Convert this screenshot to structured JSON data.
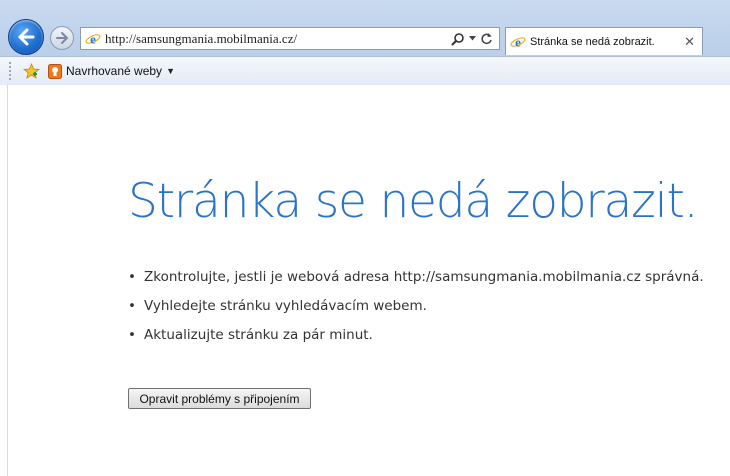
{
  "browser": {
    "address_url": "http://samsungmania.mobilmania.cz/",
    "tab_title": "Stránka se nedá zobrazit.",
    "tab_close": "✕",
    "favorites_bar": {
      "suggested_sites_label": "Navrhované weby",
      "dropdown_glyph": "▼"
    },
    "icons": {
      "back": "back-arrow-icon",
      "forward": "forward-arrow-icon",
      "page": "ie-logo-icon",
      "search": "search-icon",
      "refresh": "refresh-icon",
      "favorites": "favorites-star-icon",
      "suggested": "suggested-sites-icon"
    }
  },
  "error_page": {
    "heading": "Stránka se nedá zobrazit.",
    "bullet": "•",
    "tips": [
      "Zkontrolujte, jestli je webová adresa http://samsungmania.mobilmania.cz správná.",
      "Vyhledejte stránku vyhledávacím webem.",
      "Aktualizujte stránku za pár minut."
    ],
    "fix_button": "Opravit problémy s připojením"
  },
  "colors": {
    "heading": "#2a73c8",
    "chrome": "#bcd0ea"
  }
}
